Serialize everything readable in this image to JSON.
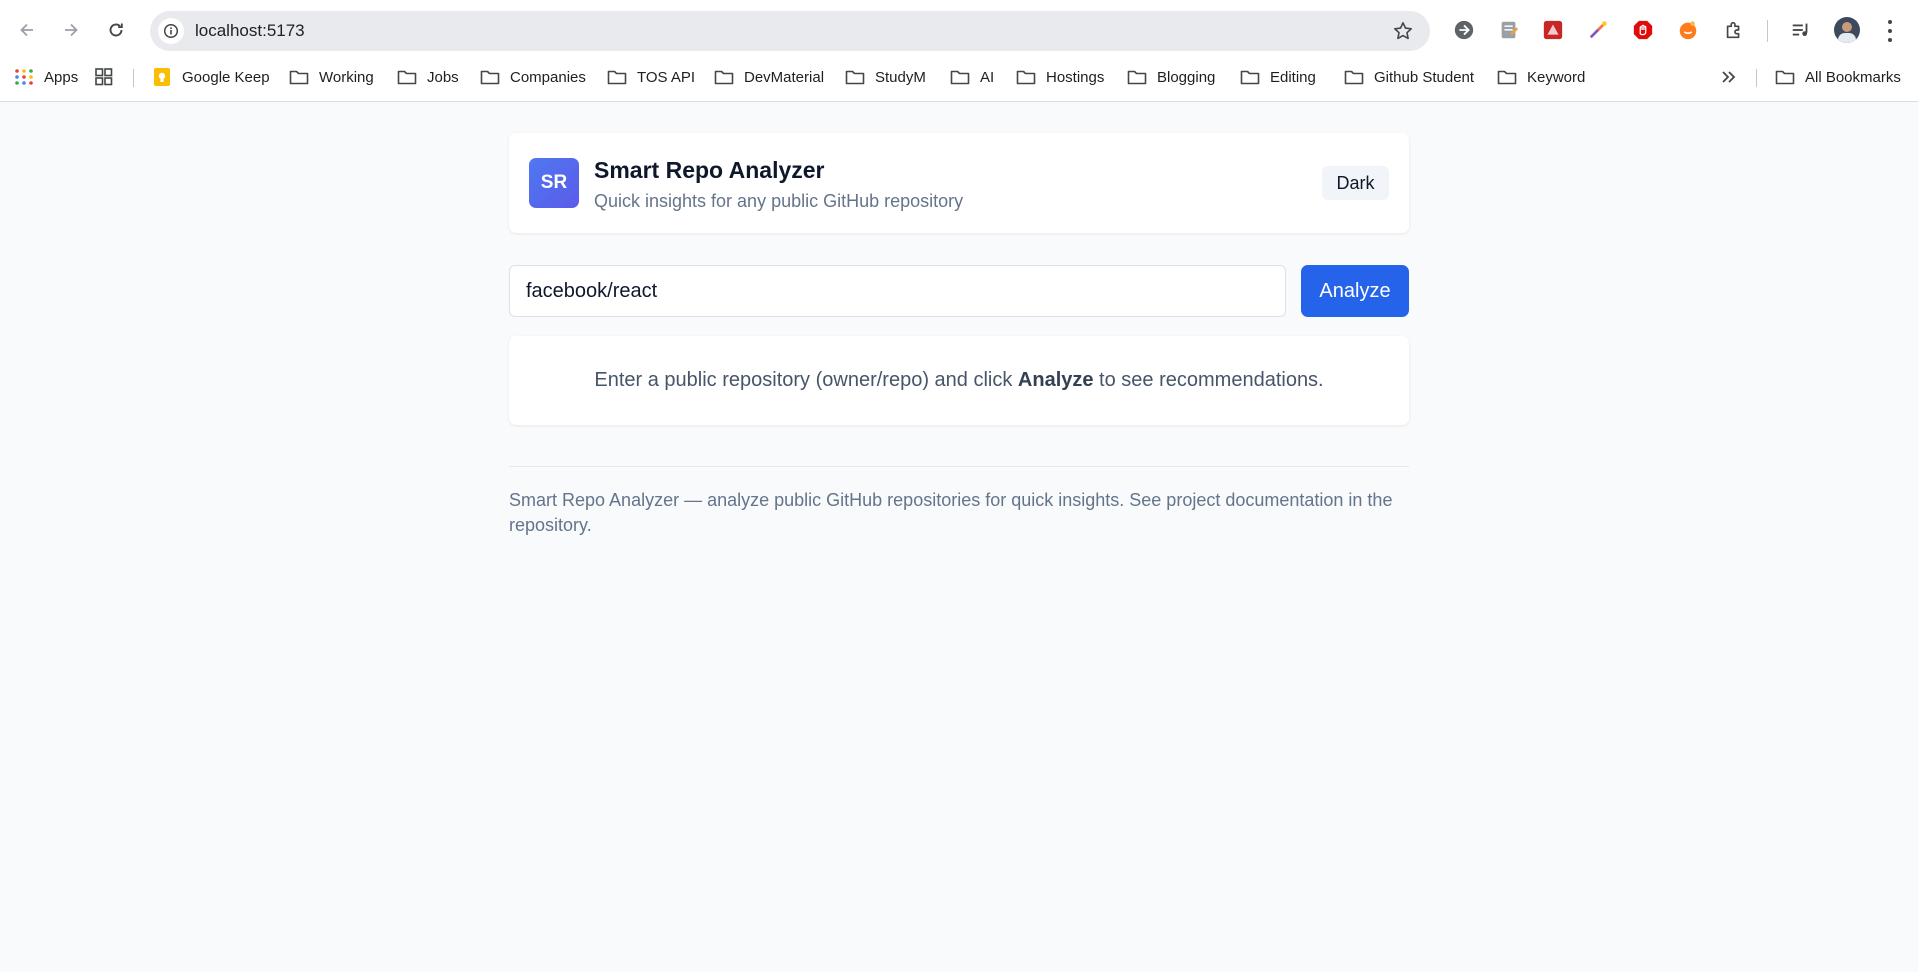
{
  "browser": {
    "url": "localhost:5173",
    "bookmarks": [
      {
        "label": "Apps",
        "icon": "apps-grid-icon"
      },
      {
        "label": "",
        "icon": "tab-groups-icon"
      },
      {
        "label": "Google Keep",
        "icon": "google-keep-icon"
      },
      {
        "label": "Working",
        "icon": "folder-icon"
      },
      {
        "label": "Jobs",
        "icon": "folder-icon"
      },
      {
        "label": "Companies",
        "icon": "folder-icon"
      },
      {
        "label": "TOS API",
        "icon": "folder-icon"
      },
      {
        "label": "DevMaterial",
        "icon": "folder-icon"
      },
      {
        "label": "StudyM",
        "icon": "folder-icon"
      },
      {
        "label": "AI",
        "icon": "folder-icon"
      },
      {
        "label": "Hostings",
        "icon": "folder-icon"
      },
      {
        "label": "Blogging",
        "icon": "folder-icon"
      },
      {
        "label": "Editing",
        "icon": "folder-icon"
      },
      {
        "label": "Github Student",
        "icon": "folder-icon"
      },
      {
        "label": "Keyword",
        "icon": "folder-icon"
      }
    ],
    "all_bookmarks_label": "All Bookmarks"
  },
  "header": {
    "logo_text": "SR",
    "title": "Smart Repo Analyzer",
    "subtitle": "Quick insights for any public GitHub repository",
    "theme_toggle_label": "Dark"
  },
  "search": {
    "value": "facebook/react",
    "button_label": "Analyze"
  },
  "hint": {
    "before": "Enter a public repository (owner/repo) and click ",
    "emphasis": "Analyze",
    "after": " to see recommendations."
  },
  "footer": {
    "text": "Smart Repo Analyzer — analyze public GitHub repositories for quick insights. See project documentation in the repository."
  },
  "colors": {
    "accent": "#2563eb",
    "page_background": "#f8fafc",
    "logo_gradient_start": "#4f78f0",
    "logo_gradient_end": "#5b5bea"
  }
}
